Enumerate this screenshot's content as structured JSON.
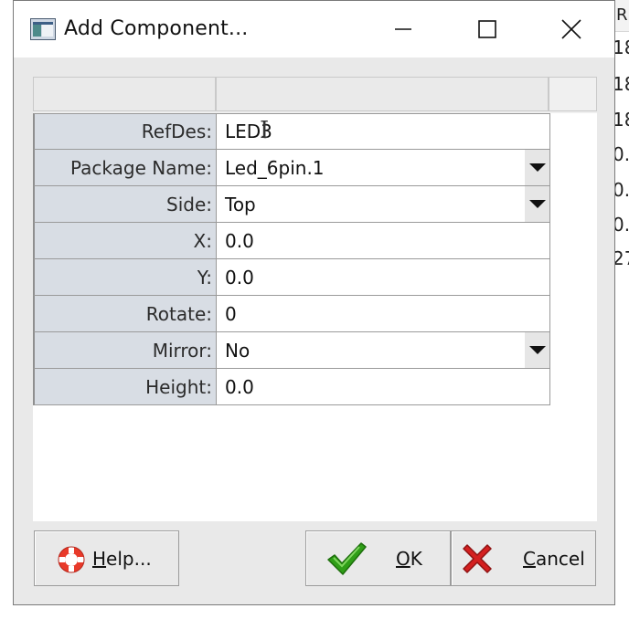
{
  "window": {
    "title": "Add Component..."
  },
  "background_app": {
    "header_text": "R",
    "cells": [
      "18",
      "18",
      "18",
      "0.",
      "0.",
      "0.",
      "27"
    ]
  },
  "form": {
    "rows": [
      {
        "label": "RefDes:",
        "value": "LED3",
        "dropdown": false
      },
      {
        "label": "Package Name:",
        "value": "Led_6pin.1",
        "dropdown": true
      },
      {
        "label": "Side:",
        "value": "Top",
        "dropdown": true
      },
      {
        "label": "X:",
        "value": "0.0",
        "dropdown": false
      },
      {
        "label": "Y:",
        "value": "0.0",
        "dropdown": false
      },
      {
        "label": "Rotate:",
        "value": "0",
        "dropdown": false
      },
      {
        "label": "Mirror:",
        "value": "No",
        "dropdown": true
      },
      {
        "label": "Height:",
        "value": "0.0",
        "dropdown": false
      }
    ]
  },
  "buttons": {
    "help": {
      "mnemonic": "H",
      "rest": "elp...",
      "icon": "lifebuoy-icon"
    },
    "ok": {
      "mnemonic": "O",
      "rest": "K",
      "icon": "checkmark-icon"
    },
    "cancel": {
      "mnemonic": "C",
      "rest": "ancel",
      "icon": "red-x-icon"
    }
  },
  "colors": {
    "label_bg": "#d8dde4",
    "dialog_bg": "#e9e9e9",
    "ok_icon": "#2f9e17",
    "cancel_icon": "#d42020",
    "help_icon": "#e83a2a"
  }
}
